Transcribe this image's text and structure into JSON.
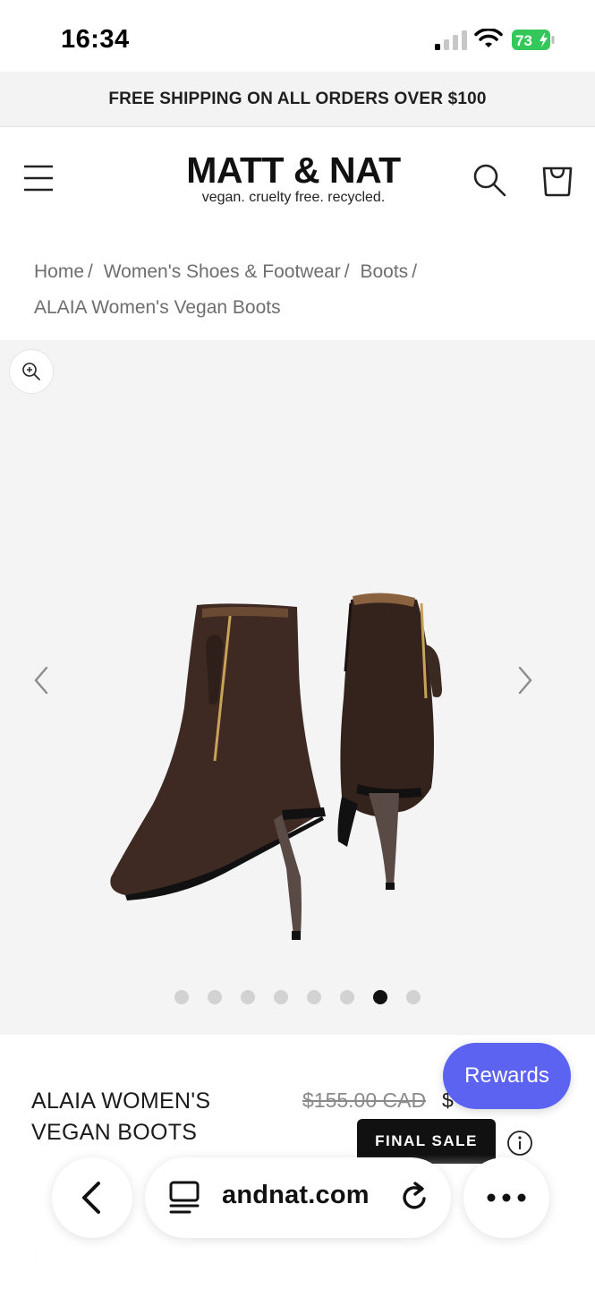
{
  "status_bar": {
    "time": "16:34",
    "battery": "73",
    "signal_bars_active": 1
  },
  "promo": {
    "text": "FREE SHIPPING ON ALL ORDERS OVER $100"
  },
  "header": {
    "logo_main": "MATT & NAT",
    "logo_tagline": "vegan. cruelty free. recycled."
  },
  "breadcrumb": {
    "items": [
      "Home",
      "Women's Shoes & Footwear",
      "Boots",
      "ALAIA Women's Vegan Boots"
    ]
  },
  "gallery": {
    "image_count": 8,
    "active_index": 6,
    "icons": [
      "zoom-icon",
      "chevron-left-icon",
      "chevron-right-icon"
    ]
  },
  "product": {
    "title_line1": "ALAIA WOMEN'S",
    "title_line2": "VEGAN BOOTS",
    "price_old": "$155.00 CAD",
    "price_new": "$",
    "badge": "FINAL SALE"
  },
  "rewards": {
    "label": "Rewards"
  },
  "browser": {
    "url": "andnat.com"
  },
  "colors": {
    "rewards_bg": "#5b63f0",
    "badge_bg": "#111111",
    "gallery_bg": "#f4f4f4",
    "promo_bg": "#f3f3f3",
    "battery_green": "#34c759"
  }
}
